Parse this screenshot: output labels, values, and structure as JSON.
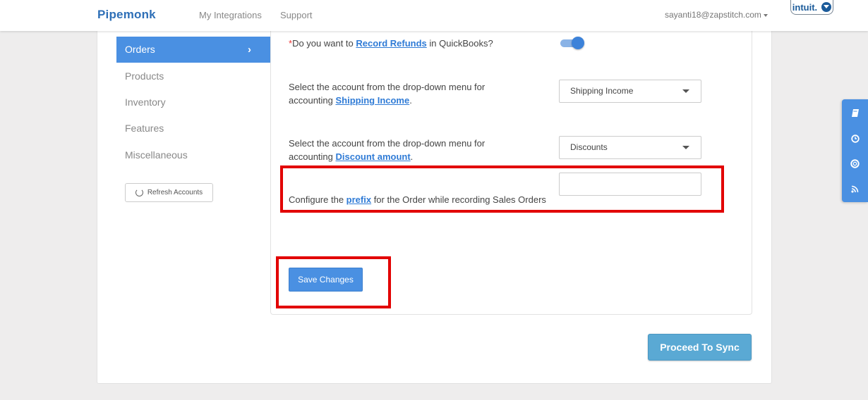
{
  "nav": {
    "brand": "Pipemonk",
    "links": [
      "My Integrations",
      "Support"
    ],
    "user_email": "sayanti18@zapstitch.com",
    "intuit_label": "intuit."
  },
  "sidebar": {
    "items": [
      {
        "label": "Orders",
        "active": true
      },
      {
        "label": "Products"
      },
      {
        "label": "Inventory"
      },
      {
        "label": "Features"
      },
      {
        "label": "Miscellaneous"
      }
    ],
    "refresh_label": "Refresh Accounts"
  },
  "settings": {
    "refunds": {
      "required_mark": "*",
      "pre": "Do you want to ",
      "link": "Record Refunds",
      "post": " in QuickBooks?",
      "toggle_on": true
    },
    "shipping": {
      "pre": "Select the account from the drop-down menu for accounting ",
      "link": "Shipping Income",
      "post": ".",
      "selected": "Shipping Income"
    },
    "discount": {
      "pre": "Select the account from the drop-down menu for accounting ",
      "link": "Discount amount",
      "post": ".",
      "selected": "Discounts"
    },
    "prefix": {
      "pre": "Configure the ",
      "link": "prefix",
      "post": " for the Order while recording Sales Orders",
      "value": ""
    }
  },
  "buttons": {
    "save": "Save Changes",
    "proceed": "Proceed To Sync"
  },
  "colors": {
    "brand": "#2e6fb7",
    "accent": "#4a90e2",
    "highlight": "#e20000",
    "proceed": "#5aa9d4"
  },
  "float_toolbar": {
    "icons": [
      "book-icon",
      "clock-icon",
      "lifebuoy-icon",
      "rss-icon"
    ]
  }
}
